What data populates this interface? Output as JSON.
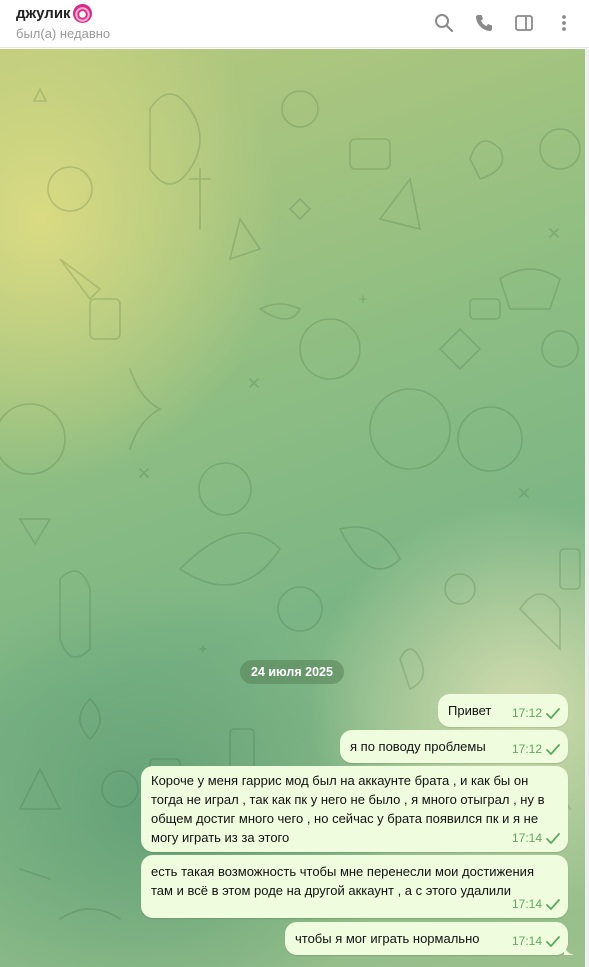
{
  "header": {
    "title": "джулик",
    "status": "был(а) недавно",
    "icons": [
      "search-icon",
      "phone-icon",
      "sidebar-toggle-icon",
      "more-vertical-icon"
    ]
  },
  "chat": {
    "date_separator": "24 июля 2025",
    "messages": [
      {
        "text": "Привет",
        "time": "17:12",
        "status": "sent"
      },
      {
        "text": "я по поводу проблемы",
        "time": "17:12",
        "status": "sent"
      },
      {
        "text": "Короче у меня гаррис мод был на аккаунте брата , и как бы он тогда не играл , так как пк у него не было , я много отыграл , ну в общем достиг много чего , но сейчас у брата появился пк и я не могу играть из за этого",
        "time": "17:14",
        "status": "sent"
      },
      {
        "text": "есть такая возможность чтобы мне перенесли мои достижения там и всё в этом роде на другой аккаунт , а с этого удалили",
        "time": "17:14",
        "status": "sent"
      },
      {
        "text": "чтобы я мог играть нормально",
        "time": "17:14",
        "status": "sent"
      }
    ]
  },
  "colors": {
    "bubble_out": "#effdde",
    "check": "#5fa85f",
    "date_pill": "#588256"
  }
}
